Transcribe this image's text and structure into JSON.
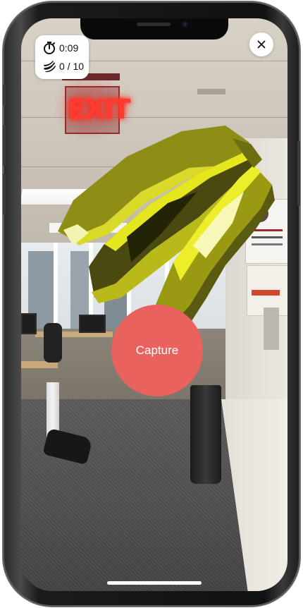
{
  "hud": {
    "timer_text": "0:09",
    "timer_icon": "stopwatch-icon",
    "collected_text": "0 / 10",
    "collected_icon": "banana-icon"
  },
  "controls": {
    "close_icon": "close-icon",
    "capture_label": "Capture"
  },
  "scene": {
    "exit_sign_text": "EXIT",
    "ar_object": "banana-model",
    "banana_color": "#e2e21a",
    "banana_shadow_color": "#2b2b0a"
  },
  "colors": {
    "capture_button": "#e9625e",
    "hud_background": "#ffffff"
  }
}
